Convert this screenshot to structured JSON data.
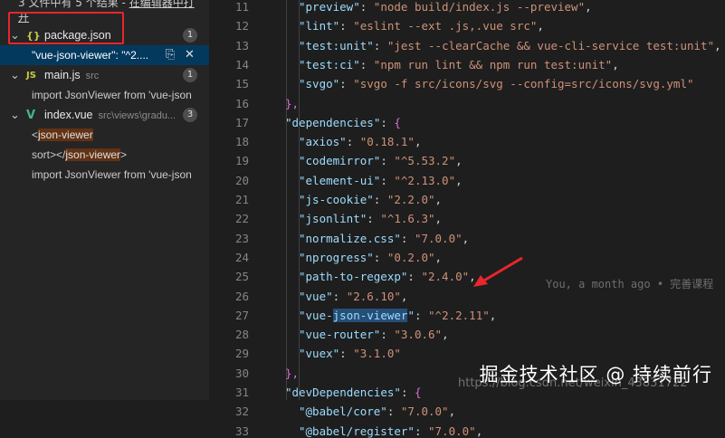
{
  "sidebar": {
    "summary_prefix": "3 文件中有 5 个结果 - ",
    "summary_link": "在编辑器中打开",
    "files": [
      {
        "name": "package.json",
        "path": "",
        "count": "1",
        "icon": "{}",
        "matches": [
          {
            "text": "\"vue-json-viewer\": \"^2...."
          }
        ]
      },
      {
        "name": "main.js",
        "path": "src",
        "count": "1",
        "icon": "JS",
        "matches": [
          {
            "pre": "import JsonViewer from 'vue-json",
            "hl": ""
          }
        ]
      },
      {
        "name": "index.vue",
        "path": "src\\views\\gradu...",
        "count": "3",
        "icon": "V",
        "matches": [
          {
            "pre": "<",
            "hl": "json-viewer"
          },
          {
            "pre": "sort></",
            "hl": "json-viewer",
            "post": ">"
          },
          {
            "pre": "import JsonViewer from 'vue-json",
            "hl": ""
          }
        ]
      }
    ]
  },
  "editor": {
    "lines": [
      {
        "n": "11",
        "indent": 1,
        "key": "preview",
        "val": "node build/index.js --preview",
        "tail": ","
      },
      {
        "n": "12",
        "indent": 1,
        "key": "lint",
        "val": "eslint --ext .js,.vue src",
        "tail": ","
      },
      {
        "n": "13",
        "indent": 1,
        "key": "test:unit",
        "val": "jest --clearCache && vue-cli-service test:unit",
        "tail": ","
      },
      {
        "n": "14",
        "indent": 1,
        "key": "test:ci",
        "val": "npm run lint && npm run test:unit",
        "tail": ","
      },
      {
        "n": "15",
        "indent": 1,
        "key": "svgo",
        "val": "svgo -f src/icons/svg --config=src/icons/svg.yml",
        "tail": ""
      },
      {
        "n": "16",
        "indent": 0,
        "raw": "},"
      },
      {
        "n": "17",
        "indent": 0,
        "key": "dependencies",
        "open": "{"
      },
      {
        "n": "18",
        "indent": 1,
        "key": "axios",
        "val": "0.18.1",
        "tail": ","
      },
      {
        "n": "19",
        "indent": 1,
        "key": "codemirror",
        "val": "^5.53.2",
        "tail": ","
      },
      {
        "n": "20",
        "indent": 1,
        "key": "element-ui",
        "val": "^2.13.0",
        "tail": ","
      },
      {
        "n": "21",
        "indent": 1,
        "key": "js-cookie",
        "val": "2.2.0",
        "tail": ","
      },
      {
        "n": "22",
        "indent": 1,
        "key": "jsonlint",
        "val": "^1.6.3",
        "tail": ","
      },
      {
        "n": "23",
        "indent": 1,
        "key": "normalize.css",
        "val": "7.0.0",
        "tail": ","
      },
      {
        "n": "24",
        "indent": 1,
        "key": "nprogress",
        "val": "0.2.0",
        "tail": ","
      },
      {
        "n": "25",
        "indent": 1,
        "key": "path-to-regexp",
        "val": "2.4.0",
        "tail": ","
      },
      {
        "n": "26",
        "indent": 1,
        "key": "vue",
        "val": "2.6.10",
        "tail": ","
      },
      {
        "n": "27",
        "indent": 1,
        "key": "vue-json-viewer",
        "val": "^2.2.11",
        "tail": ",",
        "selected": true
      },
      {
        "n": "28",
        "indent": 1,
        "key": "vue-router",
        "val": "3.0.6",
        "tail": ","
      },
      {
        "n": "29",
        "indent": 1,
        "key": "vuex",
        "val": "3.1.0",
        "tail": ""
      },
      {
        "n": "30",
        "indent": 0,
        "raw": "},"
      },
      {
        "n": "31",
        "indent": 0,
        "key": "devDependencies",
        "open": "{"
      },
      {
        "n": "32",
        "indent": 1,
        "key": "@babel/core",
        "val": "7.0.0",
        "tail": ","
      },
      {
        "n": "33",
        "indent": 1,
        "key": "@babel/register",
        "val": "7.0.0",
        "tail": ","
      }
    ],
    "blame": "You, a month ago • 完善课程",
    "watermark": "掘金技术社区 @ 持续前行",
    "watermark_url": "https://blog.csdn.net/weixin_43831722"
  },
  "colors": {
    "sidebar_bg": "#252526",
    "editor_bg": "#1e1e1e",
    "selected_row": "#04395e",
    "key": "#9cdcfe",
    "string": "#ce9178",
    "highlight_box": "#e8262c"
  }
}
